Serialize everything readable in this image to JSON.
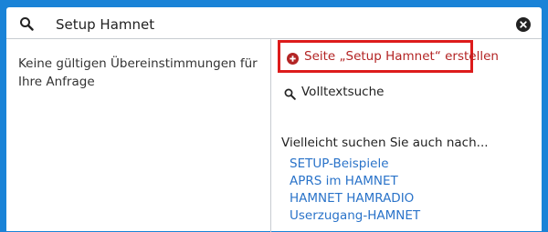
{
  "search": {
    "value": "Setup Hamnet",
    "icon": "search-icon",
    "clear_icon": "clear-icon"
  },
  "results": {
    "no_results_text": "Keine gültigen Übereinstimmungen für Ihre Anfrage"
  },
  "actions": {
    "create_page_label": "Seite „Setup Hamnet“ erstellen",
    "create_page_icon": "plus-circle-icon",
    "fulltext_label": "Volltextsuche",
    "fulltext_icon": "search-icon"
  },
  "suggestions": {
    "heading": "Vielleicht suchen Sie auch nach...",
    "items": [
      "SETUP-Beispiele",
      "APRS im HAMNET",
      "HAMNET HAMRADIO",
      "Userzugang-HAMNET"
    ]
  },
  "colors": {
    "header_bg": "#1a83d7",
    "highlight_border": "#dd1b1b",
    "create_link": "#b32424",
    "link": "#2a73c9"
  }
}
